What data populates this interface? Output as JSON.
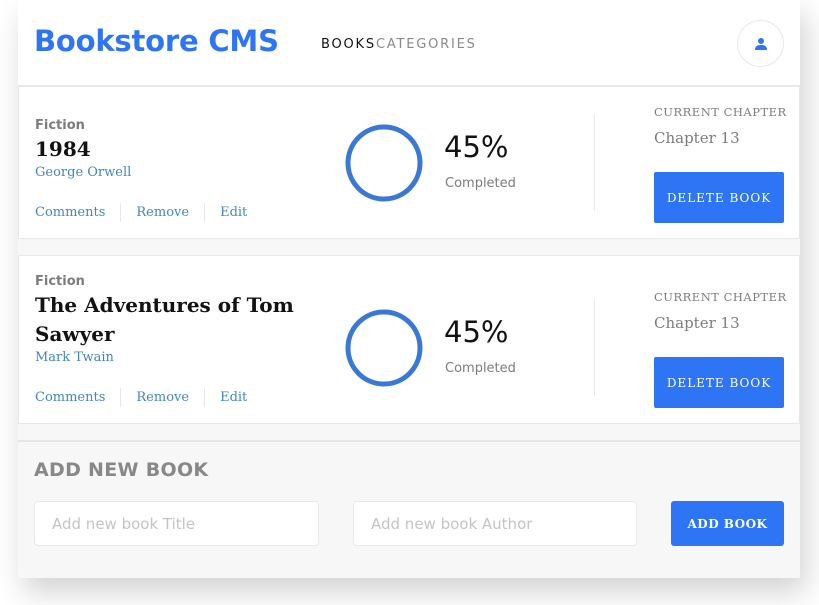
{
  "header": {
    "brand": "Bookstore CMS",
    "nav": [
      "BOOKS",
      "CATEGORIES"
    ],
    "user_icon": "user-icon"
  },
  "books": [
    {
      "genre": "Fiction",
      "title": "1984",
      "author": "George Orwell",
      "actions": [
        "Comments",
        "Remove",
        "Edit"
      ],
      "progress_percent": 45,
      "percent_label": "45%",
      "completed_label": "Completed",
      "current_chapter_label": "CURRENT CHAPTER",
      "chapter": "Chapter 13",
      "delete_label": "DELETE BOOK"
    },
    {
      "genre": "Fiction",
      "title": "The Adventures of Tom Sawyer",
      "author": "Mark Twain",
      "actions": [
        "Comments",
        "Remove",
        "Edit"
      ],
      "progress_percent": 45,
      "percent_label": "45%",
      "completed_label": "Completed",
      "current_chapter_label": "CURRENT CHAPTER",
      "chapter": "Chapter 13",
      "delete_label": "DELETE BOOK"
    }
  ],
  "add_book": {
    "heading": "ADD NEW BOOK",
    "title_placeholder": "Add new book Title",
    "author_placeholder": "Add new book Author",
    "button_label": "ADD BOOK"
  },
  "colors": {
    "accent": "#2d75f5",
    "ring": "#3a78d8",
    "link": "#4386bf"
  }
}
